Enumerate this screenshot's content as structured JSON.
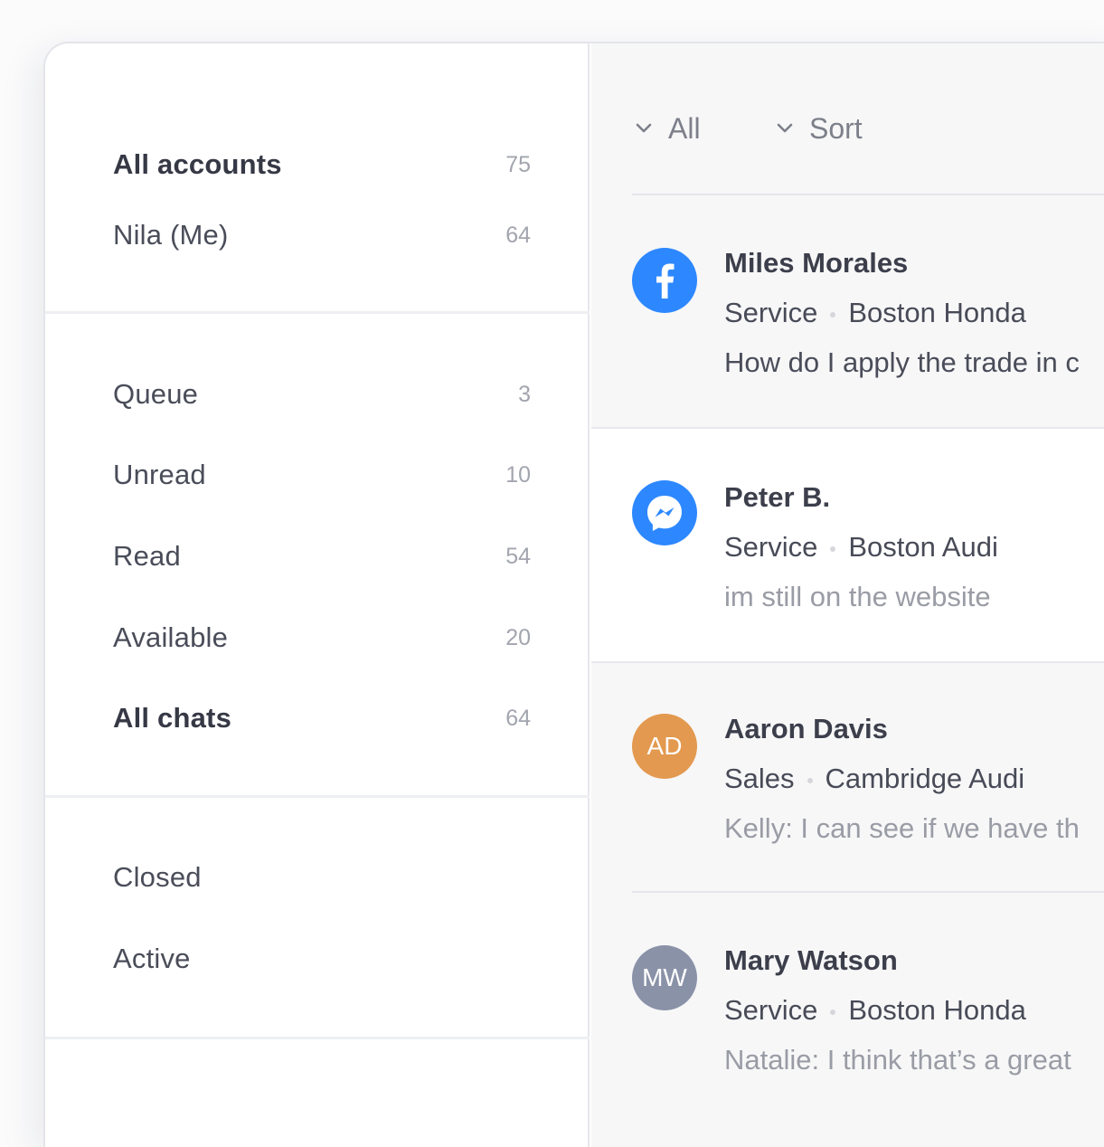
{
  "sidebar": {
    "accounts": [
      {
        "label": "All accounts",
        "count": "75"
      },
      {
        "label": "Nila (Me)",
        "count": "64"
      }
    ],
    "views": [
      {
        "label": "Queue",
        "count": "3"
      },
      {
        "label": "Unread",
        "count": "10"
      },
      {
        "label": "Read",
        "count": "54"
      },
      {
        "label": "Available",
        "count": "20"
      },
      {
        "label": "All chats",
        "count": "64"
      }
    ],
    "status": [
      {
        "label": "Closed"
      },
      {
        "label": "Active"
      }
    ]
  },
  "filters": {
    "all_label": "All",
    "sort_label": "Sort",
    "icon": "chevron-down-icon"
  },
  "conversations": [
    {
      "name": "Miles Morales",
      "department": "Service",
      "dealer": "Boston Honda",
      "message": "How do I apply the trade in c",
      "channel": "facebook-icon",
      "channel_color": "#2d88ff"
    },
    {
      "name": "Peter B.",
      "department": "Service",
      "dealer": "Boston Audi",
      "message": "im still on the website",
      "channel": "messenger-icon",
      "channel_color": "#2d88ff"
    },
    {
      "name": "Aaron Davis",
      "department": "Sales",
      "dealer": "Cambridge Audi",
      "message": "Kelly: I can see if we have th",
      "initials": "AD",
      "avatar_color": "#e3994f"
    },
    {
      "name": "Mary Watson",
      "department": "Service",
      "dealer": "Boston Honda",
      "message": "Natalie: I think that’s a great",
      "initials": "MW",
      "avatar_color": "#8a92a8"
    }
  ],
  "colors": {
    "accent": "#2d88ff",
    "text_primary": "#3c3f4b",
    "text_muted": "#9a9ca5"
  }
}
